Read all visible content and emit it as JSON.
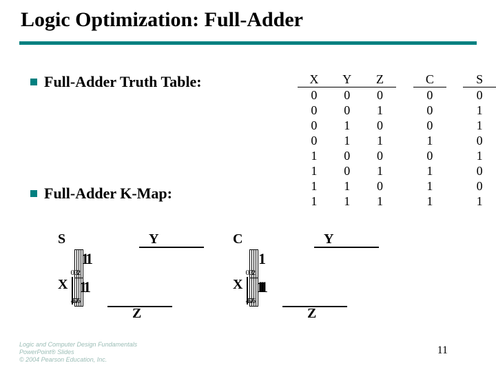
{
  "title": "Logic Optimization: Full-Adder",
  "bullets": {
    "b1": "Full-Adder Truth Table:",
    "b2": "Full-Adder K-Map:"
  },
  "truth_table": {
    "headers": {
      "X": "X",
      "Y": "Y",
      "Z": "Z",
      "C": "C",
      "S": "S"
    },
    "rows": [
      {
        "X": "0",
        "Y": "0",
        "Z": "0",
        "C": "0",
        "S": "0"
      },
      {
        "X": "0",
        "Y": "0",
        "Z": "1",
        "C": "0",
        "S": "1"
      },
      {
        "X": "0",
        "Y": "1",
        "Z": "0",
        "C": "0",
        "S": "1"
      },
      {
        "X": "0",
        "Y": "1",
        "Z": "1",
        "C": "1",
        "S": "0"
      },
      {
        "X": "1",
        "Y": "0",
        "Z": "0",
        "C": "0",
        "S": "1"
      },
      {
        "X": "1",
        "Y": "0",
        "Z": "1",
        "C": "1",
        "S": "0"
      },
      {
        "X": "1",
        "Y": "1",
        "Z": "0",
        "C": "1",
        "S": "0"
      },
      {
        "X": "1",
        "Y": "1",
        "Z": "1",
        "C": "1",
        "S": "1"
      }
    ]
  },
  "kmap_vars": {
    "S": "S",
    "C": "C",
    "X": "X",
    "Y": "Y",
    "Z": "Z"
  },
  "kmap_S": {
    "cells": [
      {
        "idx": "0",
        "val": ""
      },
      {
        "idx": "1",
        "val": "1"
      },
      {
        "idx": "3",
        "val": ""
      },
      {
        "idx": "2",
        "val": "1"
      },
      {
        "idx": "4",
        "val": "1"
      },
      {
        "idx": "5",
        "val": ""
      },
      {
        "idx": "7",
        "val": "1"
      },
      {
        "idx": "6",
        "val": ""
      }
    ]
  },
  "kmap_C": {
    "cells": [
      {
        "idx": "0",
        "val": ""
      },
      {
        "idx": "1",
        "val": ""
      },
      {
        "idx": "3",
        "val": "1"
      },
      {
        "idx": "2",
        "val": ""
      },
      {
        "idx": "4",
        "val": ""
      },
      {
        "idx": "5",
        "val": "1"
      },
      {
        "idx": "7",
        "val": "1"
      },
      {
        "idx": "6",
        "val": "1"
      }
    ]
  },
  "footer": {
    "l1": "Logic and Computer Design Fundamentals",
    "l2": "PowerPoint® Slides",
    "l3": "© 2004 Pearson Education, Inc."
  },
  "pagenum": "11"
}
